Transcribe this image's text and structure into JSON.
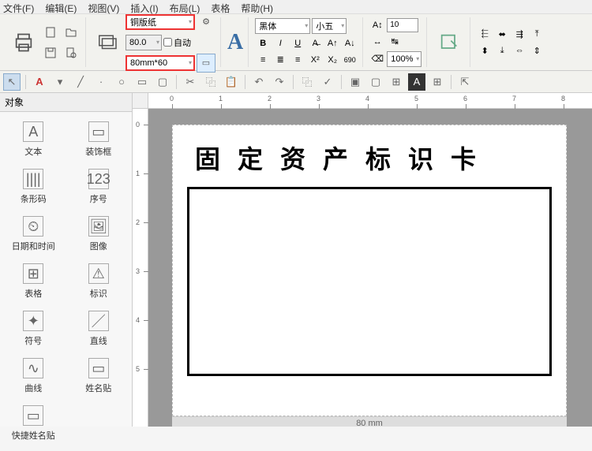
{
  "menu": {
    "file": "文件(F)",
    "edit": "编辑(E)",
    "view": "视图(V)",
    "insert": "插入(I)",
    "layout": "布局(L)",
    "table": "表格",
    "help": "帮助(H)"
  },
  "ribbon": {
    "paper_stock": "铜版纸",
    "width": "80.0",
    "size_preset": "80mm*60",
    "auto": "自动",
    "font_family": "黑体",
    "font_size": "小五",
    "leading": "10",
    "zoom": "100%",
    "scale_btn": "690"
  },
  "sidebar": {
    "title": "对象",
    "tools": [
      {
        "label": "文本",
        "icon": "A"
      },
      {
        "label": "装饰框",
        "icon": "▭"
      },
      {
        "label": "条形码",
        "icon": "||||"
      },
      {
        "label": "序号",
        "icon": "123"
      },
      {
        "label": "日期和时间",
        "icon": "⏲"
      },
      {
        "label": "图像",
        "icon": "🖼"
      },
      {
        "label": "表格",
        "icon": "⊞"
      },
      {
        "label": "标识",
        "icon": "⚠"
      },
      {
        "label": "符号",
        "icon": "✦"
      },
      {
        "label": "直线",
        "icon": "／"
      },
      {
        "label": "曲线",
        "icon": "∿"
      },
      {
        "label": "姓名贴",
        "icon": "▭"
      },
      {
        "label": "快捷姓名贴",
        "icon": "▭"
      }
    ]
  },
  "quickbar": {
    "items": [
      "select",
      "text-A",
      "line",
      "dot",
      "oval",
      "rect",
      "rect2",
      "cut",
      "copy",
      "paste",
      "undo",
      "redo",
      "copy2",
      "apply",
      "bring-front",
      "send-back",
      "align",
      "grid",
      "export"
    ]
  },
  "ruler": {
    "h": [
      0,
      1,
      2,
      3,
      4,
      5,
      6,
      7,
      8
    ],
    "v": [
      0,
      1,
      2,
      3,
      4,
      5
    ]
  },
  "canvas": {
    "title": "固定资产标识卡",
    "footer": "80 mm"
  }
}
